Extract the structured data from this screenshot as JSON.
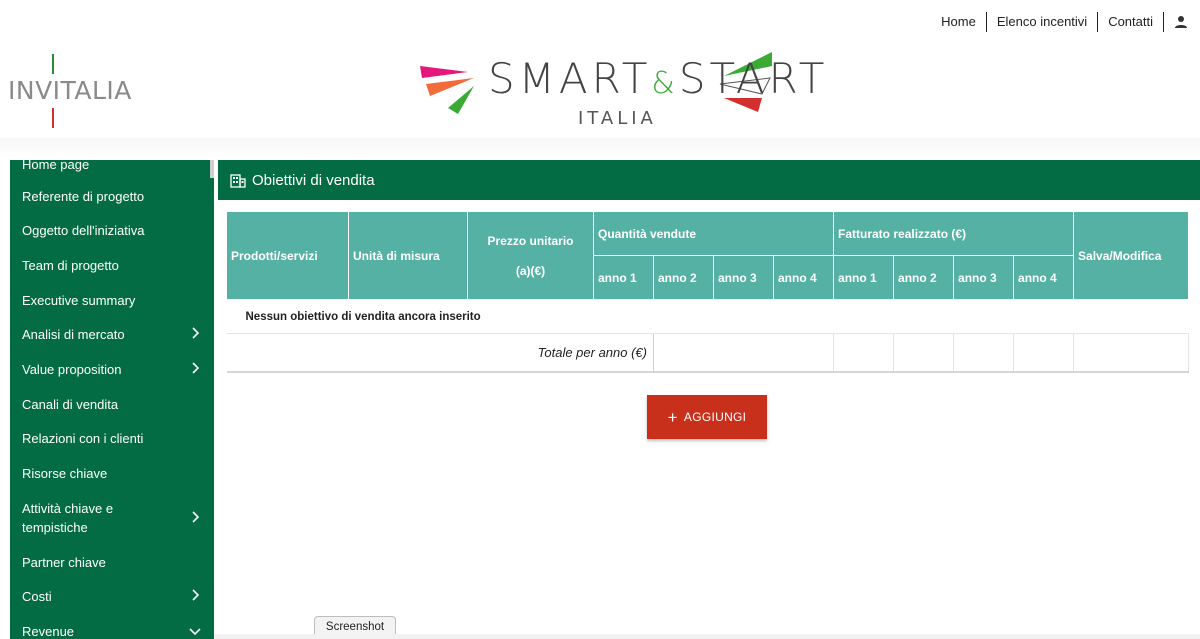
{
  "topnav": {
    "links": [
      "Home",
      "Elenco incentivi",
      "Contatti"
    ],
    "user_icon": "user-icon"
  },
  "header": {
    "left_logo": "INVITALIA",
    "center_logo_main_left": "SMART",
    "center_logo_amp": "&",
    "center_logo_main_right": "START",
    "center_logo_sub": "ITALIA",
    "colors": {
      "green": "#3aaa35",
      "red": "#d32f2f",
      "magenta": "#e4187a",
      "orange": "#f26b3a"
    }
  },
  "sidebar": {
    "bg": "#046c45",
    "items": [
      {
        "label": "Home page",
        "chevron": ""
      },
      {
        "label": "Referente di progetto",
        "chevron": ""
      },
      {
        "label": "Oggetto dell'iniziativa",
        "chevron": ""
      },
      {
        "label": "Team di progetto",
        "chevron": ""
      },
      {
        "label": "Executive summary",
        "chevron": ""
      },
      {
        "label": "Analisi di mercato",
        "chevron": "›"
      },
      {
        "label": "Value proposition",
        "chevron": "›"
      },
      {
        "label": "Canali di vendita",
        "chevron": ""
      },
      {
        "label": "Relazioni con i clienti",
        "chevron": ""
      },
      {
        "label": "Risorse chiave",
        "chevron": ""
      },
      {
        "label": "Attività chiave e tempistiche",
        "chevron": "›"
      },
      {
        "label": "Partner chiave",
        "chevron": ""
      },
      {
        "label": "Costi",
        "chevron": "›"
      },
      {
        "label": "Revenue",
        "chevron": "⌄"
      }
    ]
  },
  "panel": {
    "title": "Obiettivi di vendita",
    "title_icon": "building-icon"
  },
  "table": {
    "headers": {
      "prodotti": "Prodotti/servizi",
      "unita": "Unità di misura",
      "prezzo_line1": "Prezzo unitario",
      "prezzo_line2": "(a)(€)",
      "quantita": "Quantità vendute",
      "fatturato": "Fatturato realizzato (€)",
      "salva": "Salva/Modifica"
    },
    "years": [
      "anno 1",
      "anno 2",
      "anno 3",
      "anno 4"
    ],
    "empty_message": "Nessun obiettivo di vendita ancora inserito",
    "total_label": "Totale per anno (€)"
  },
  "actions": {
    "add_label": "AGGIUNGI",
    "add_color": "#c9301c"
  },
  "tooltip": "Screenshot"
}
